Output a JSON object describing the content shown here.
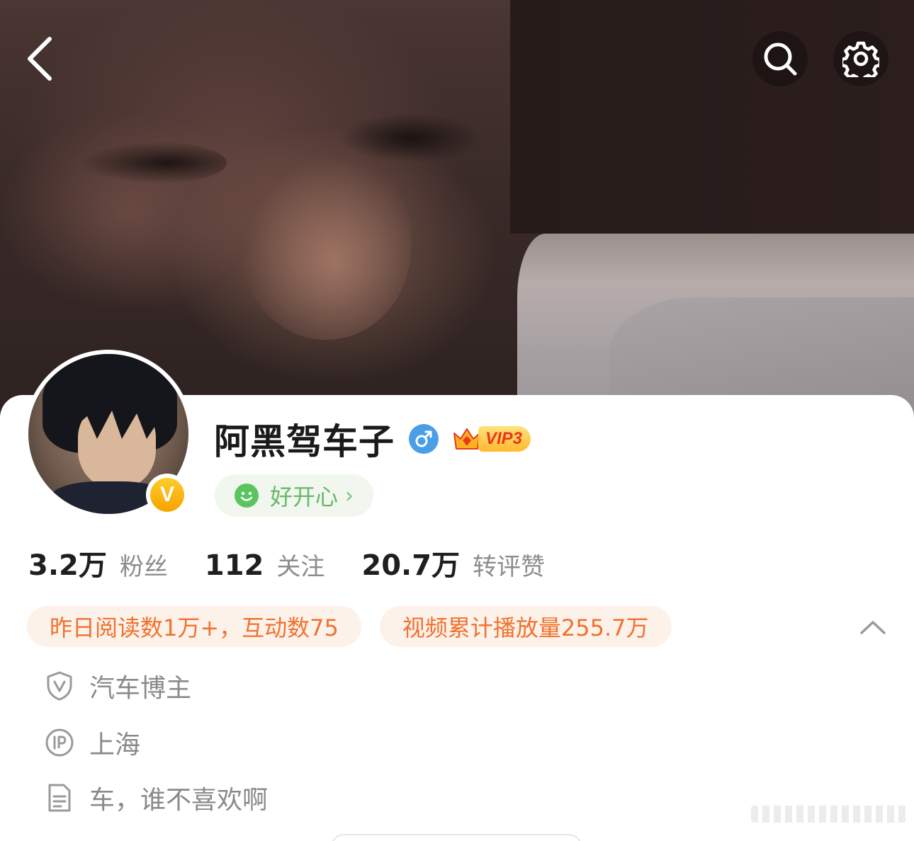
{
  "header": {
    "back_icon": "chevron-left-icon",
    "search_icon": "search-icon",
    "settings_icon": "gear-icon"
  },
  "profile": {
    "nickname": "阿黑驾车子",
    "gender_icon": "male-icon",
    "vip_label": "VIP3",
    "verified_badge_letter": "V",
    "mood": {
      "icon": "smile-icon",
      "label": "好开心",
      "chevron": "›"
    }
  },
  "stats": [
    {
      "value": "3.2万",
      "label": "粉丝"
    },
    {
      "value": "112",
      "label": "关注"
    },
    {
      "value": "20.7万",
      "label": "转评赞"
    }
  ],
  "tags": [
    "昨日阅读数1万+，互动数75",
    "视频累计播放量255.7万"
  ],
  "info": {
    "category": "汽车博主",
    "ip_location": "上海",
    "bio": "车，谁不喜欢啊"
  },
  "colors": {
    "accent_orange": "#f0722f",
    "mood_green": "#68b86a",
    "gender_blue": "#4a9ee8",
    "verify_gold": "#f5a300"
  }
}
